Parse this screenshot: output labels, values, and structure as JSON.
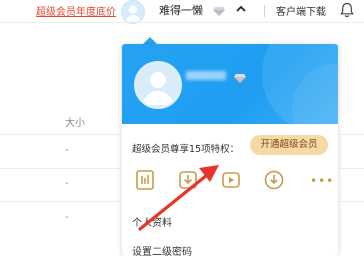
{
  "topbar": {
    "promo_label": "超级会员年度底价",
    "username": "难得一懒",
    "download_label": "客户端下载"
  },
  "file_list": {
    "size_header": "大小",
    "rows": [
      "-",
      "-",
      "-"
    ]
  },
  "popup": {
    "vip_privilege_text": "超级会员尊享15项特权：",
    "open_vip_button": "开通超级会员",
    "menu": [
      "个人资料",
      "设置二级密码"
    ],
    "feature_icons": [
      "book-icon",
      "download-box-icon",
      "video-play-icon",
      "cloud-download-icon",
      "more-icon"
    ],
    "more_label": "•••"
  },
  "colors": {
    "promo": "#e8462e",
    "header_blue": "#26a2f3",
    "button_gold": "#f6d9a5",
    "icon_gold": "#c89a4a",
    "annotation_arrow": "#e8342a"
  }
}
